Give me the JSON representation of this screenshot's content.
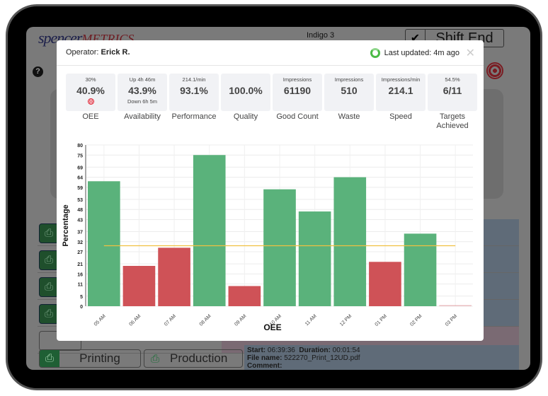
{
  "app": {
    "logo_part1": "spencer",
    "logo_part2": "METRICS",
    "machine_name": "Indigo 3",
    "shift_end_label": "Shift End",
    "help_icon": "question-circle-icon",
    "check_icon": "✔"
  },
  "bottom_bar": {
    "printing_label": "Printing",
    "production_label": "Production",
    "start_label": "Start:",
    "start_value": "06:39:36",
    "duration_label": "Duration:",
    "duration_value": "00:01:54",
    "file_label": "File name:",
    "file_value": "522270_Print_12UD.pdf",
    "comment_label": "Comment:",
    "comment_value": ""
  },
  "modal": {
    "operator_label": "Operator:",
    "operator_name": "Erick R.",
    "last_updated": "Last updated: 4m ago",
    "close_icon": "✕",
    "stats": [
      {
        "sub": "30%",
        "value": "40.9%",
        "below": "",
        "name": "OEE",
        "icon": "target-icon"
      },
      {
        "sub": "Up 4h 46m",
        "value": "43.9%",
        "below": "Down 6h 5m",
        "name": "Availability"
      },
      {
        "sub": "214.1/min",
        "value": "93.1%",
        "below": "",
        "name": "Performance"
      },
      {
        "sub": "",
        "value": "100.0%",
        "below": "",
        "name": "Quality"
      },
      {
        "sub": "Impressions",
        "value": "61190",
        "below": "",
        "name": "Good Count"
      },
      {
        "sub": "Impressions",
        "value": "510",
        "below": "",
        "name": "Waste"
      },
      {
        "sub": "Impressions/min",
        "value": "214.1",
        "below": "",
        "name": "Speed"
      },
      {
        "sub": "54.5%",
        "value": "6/11",
        "below": "",
        "name": "Targets Achieved"
      }
    ]
  },
  "chart_data": {
    "type": "bar",
    "title": "",
    "xlabel": "OEE",
    "ylabel": "Percentage",
    "categories": [
      "05 AM",
      "06 AM",
      "07 AM",
      "08 AM",
      "09 AM",
      "10 AM",
      "11 AM",
      "12 PM",
      "01 PM",
      "02 PM",
      "03 PM"
    ],
    "values": [
      62,
      20,
      29,
      75,
      10,
      58,
      47,
      64,
      22,
      36,
      0.5
    ],
    "status": [
      "above",
      "below",
      "below",
      "above",
      "below",
      "above",
      "above",
      "above",
      "below",
      "above",
      "below"
    ],
    "target": 30,
    "yticks": [
      0,
      5,
      11,
      16,
      21,
      27,
      32,
      37,
      43,
      48,
      53,
      59,
      64,
      69,
      75,
      80
    ],
    "ylim": [
      0,
      80
    ],
    "grid": true,
    "colors": {
      "above": "#5ab27b",
      "below": "#cf5257",
      "target": "#f0c040"
    }
  }
}
